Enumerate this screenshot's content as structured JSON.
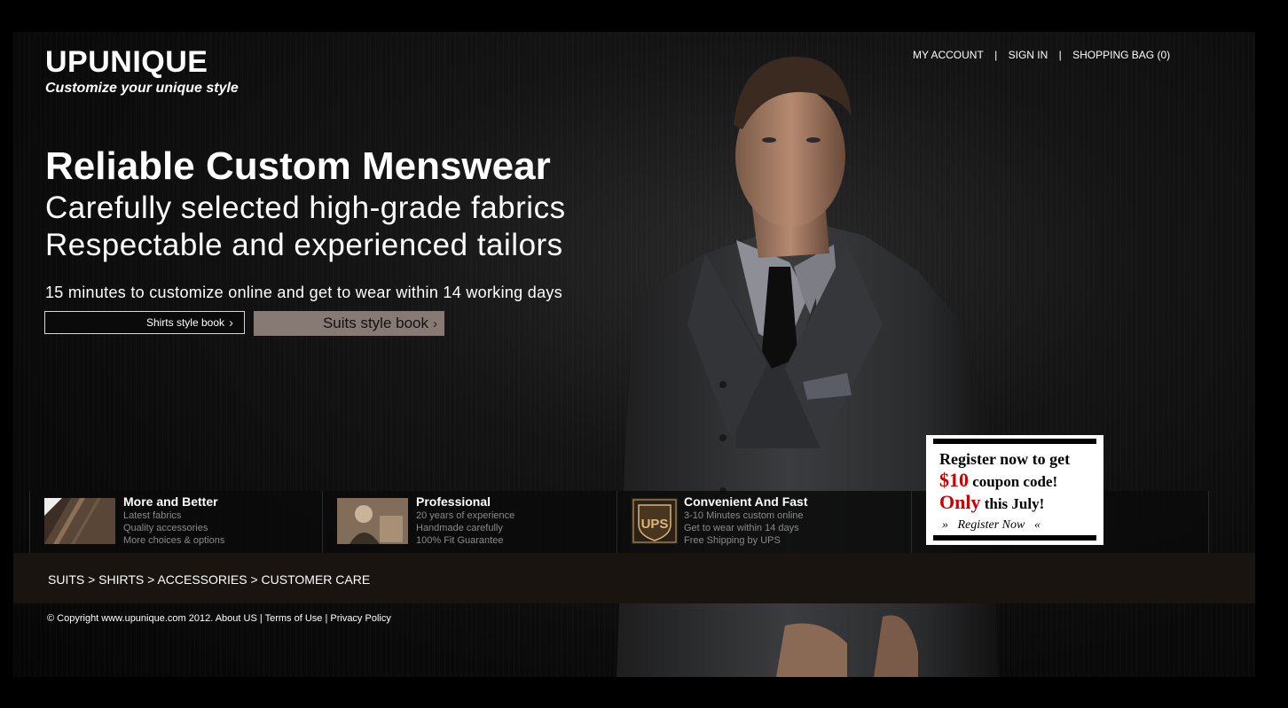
{
  "brand": {
    "name": "UPUNIQUE",
    "tagline": "Customize your unique style"
  },
  "topnav": {
    "my_account": "MY ACCOUNT",
    "separator": "|",
    "sign_in": "SIGN IN",
    "shopping_bag": "SHOPPING BAG (0)"
  },
  "hero": {
    "title": "Reliable Custom Menswear",
    "subtitle_1": "Carefully selected high-grade fabrics",
    "subtitle_2": "Respectable and experienced tailors",
    "note": "15 minutes to customize online and get to wear within 14 working days",
    "btn_shirts": "Shirts style book",
    "btn_suits": "Suits style book",
    "chevron": "›"
  },
  "features": [
    {
      "title": "More and Better",
      "lines": [
        "Latest fabrics",
        "Quality accessories",
        "More choices & options"
      ],
      "icon": "fabric-thumbnail"
    },
    {
      "title": "Professional",
      "lines": [
        "20 years of experience",
        "Handmade carefully",
        "100% Fit Guarantee"
      ],
      "icon": "tailor-thumbnail"
    },
    {
      "title": "Convenient And Fast",
      "lines": [
        "3-10 Minutes custom online",
        "Get to wear within 14 days",
        "Free Shipping by UPS"
      ],
      "icon": "ups-logo",
      "logo_text": "UPS"
    }
  ],
  "promo": {
    "line1": "Register now to get",
    "amount": "$10",
    "line2_rest": " coupon code!",
    "only": "Only",
    "line3_rest": " this July!",
    "cta": "Register Now",
    "cta_left": "»",
    "cta_right": "«"
  },
  "catbar": {
    "text": "SUITS > SHIRTS > ACCESSORIES > CUSTOMER CARE"
  },
  "footer": {
    "copyright": "© Copyright www.upunique.com 2012.",
    "about": "About US",
    "sep": "|",
    "terms": "Terms of Use",
    "privacy": "Privacy Policy"
  },
  "colors": {
    "background": "#000000",
    "accent_button": "#877a74",
    "promo_red": "#cc0000",
    "category_bar": "#1a1411"
  }
}
